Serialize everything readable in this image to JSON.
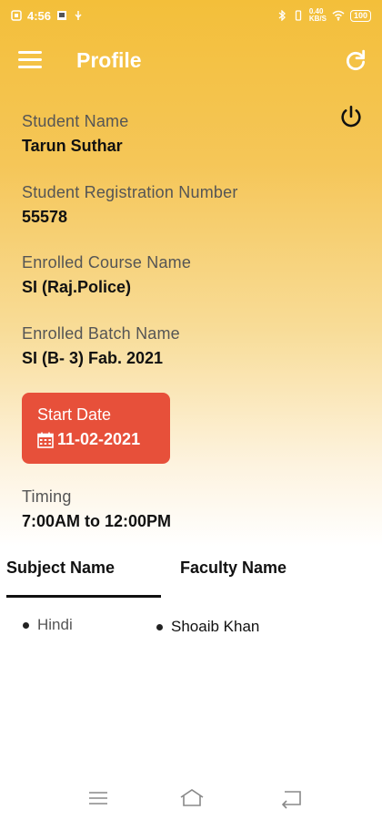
{
  "status_bar": {
    "time": "4:56",
    "network_speed": "0.40\nKB/S",
    "battery": "100"
  },
  "app_bar": {
    "title": "Profile",
    "menu_icon": "hamburger-menu-icon",
    "refresh_icon": "refresh-icon"
  },
  "profile": {
    "power_icon": "power-icon",
    "student_name_label": "Student Name",
    "student_name": "Tarun Suthar",
    "registration_label": "Student Registration Number",
    "registration_number": "55578",
    "course_label": "Enrolled Course Name",
    "course_name": "SI (Raj.Police)",
    "batch_label": "Enrolled Batch Name",
    "batch_name": "SI (B- 3) Fab. 2021",
    "start_date_label": "Start Date",
    "start_date": "11-02-2021",
    "timing_label": "Timing",
    "timing": "7:00AM to 12:00PM"
  },
  "tabs": {
    "subject": "Subject Name",
    "faculty": "Faculty Name"
  },
  "subjects": [
    {
      "subject": "Hindi",
      "faculty": "Shoaib Khan"
    }
  ],
  "colors": {
    "accent": "#f3bf3a",
    "start_card": "#e7503a"
  },
  "nav_bar": {
    "recents_icon": "recents-icon",
    "home_icon": "home-icon",
    "back_icon": "back-icon"
  }
}
